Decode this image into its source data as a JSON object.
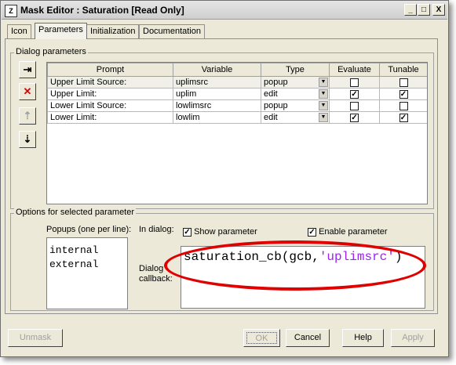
{
  "window": {
    "title": "Mask Editor : Saturation [Read Only]",
    "icon_glyph": "Z"
  },
  "title_buttons": {
    "minimize": "_",
    "maximize": "□",
    "close": "X"
  },
  "tabs": [
    {
      "label": "Icon"
    },
    {
      "label": "Parameters"
    },
    {
      "label": "Initialization"
    },
    {
      "label": "Documentation"
    }
  ],
  "dialog_parameters": {
    "legend": "Dialog parameters",
    "columns": {
      "prompt": "Prompt",
      "variable": "Variable",
      "type": "Type",
      "evaluate": "Evaluate",
      "tunable": "Tunable"
    },
    "rows": [
      {
        "prompt": "Upper Limit Source:",
        "variable": "uplimsrc",
        "type": "popup",
        "evaluate": false,
        "tunable": false
      },
      {
        "prompt": "Upper Limit:",
        "variable": "uplim",
        "type": "edit",
        "evaluate": true,
        "tunable": true
      },
      {
        "prompt": "Lower Limit Source:",
        "variable": "lowlimsrc",
        "type": "popup",
        "evaluate": false,
        "tunable": false
      },
      {
        "prompt": "Lower Limit:",
        "variable": "lowlim",
        "type": "edit",
        "evaluate": true,
        "tunable": true
      }
    ]
  },
  "side_buttons": [
    {
      "name": "insert-param-icon",
      "glyph": "⇥"
    },
    {
      "name": "delete-param-icon",
      "glyph": "✕"
    },
    {
      "name": "move-up-icon",
      "glyph": "⇡"
    },
    {
      "name": "move-down-icon",
      "glyph": "⇣"
    }
  ],
  "options": {
    "legend": "Options for selected parameter",
    "popups_label": "Popups (one per line):",
    "popups": [
      "internal",
      "external"
    ],
    "in_dialog_label": "In dialog:",
    "show_parameter": "Show parameter",
    "enable_parameter": "Enable parameter",
    "callback_label_1": "Dialog",
    "callback_label_2": "callback:",
    "callback_fn": "saturation_cb(gcb,",
    "callback_arg": "'uplimsrc'",
    "callback_close": ")"
  },
  "buttons": {
    "unmask": "Unmask",
    "ok": "OK",
    "cancel": "Cancel",
    "help": "Help",
    "apply": "Apply"
  },
  "colors": {
    "highlight_ellipse": "#e00000",
    "string_literal": "#a020f0",
    "window_bg": "#ece9d8"
  }
}
